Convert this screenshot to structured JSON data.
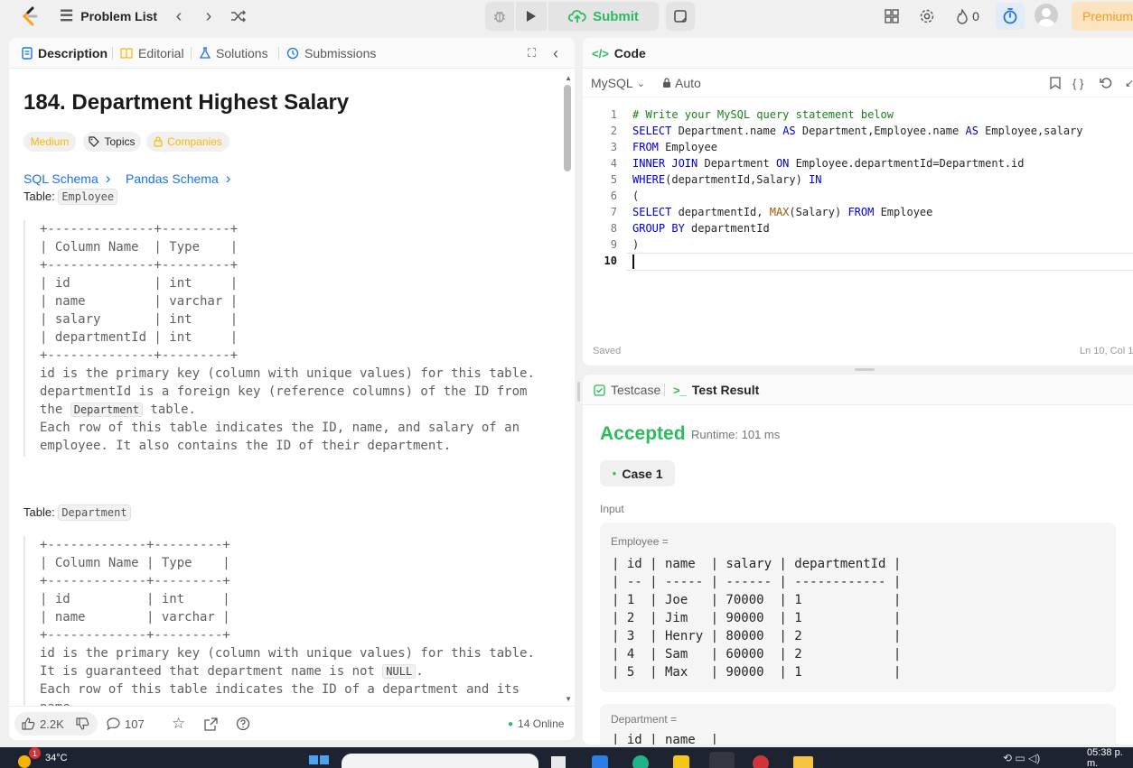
{
  "topbar": {
    "problem_list": "Problem List",
    "submit": "Submit",
    "streak_count": "0",
    "premium": "Premium"
  },
  "colors": {
    "accent_green": "#2cbb5d",
    "link_blue": "#1a73e8",
    "medium_orange": "#ffb800",
    "premium_orange": "#f0a020"
  },
  "left_tabs": [
    "Description",
    "Editorial",
    "Solutions",
    "Submissions"
  ],
  "problem": {
    "title": "184. Department Highest Salary",
    "difficulty": "Medium",
    "topics": "Topics",
    "companies": "Companies",
    "links": [
      "SQL Schema",
      "Pandas Schema"
    ],
    "table_word": "Table:",
    "table1_name": "Employee",
    "table2_name": "Department",
    "employee_schema": [
      "+--------------+---------+",
      "| Column Name  | Type    |",
      "+--------------+---------+",
      "| id           | int     |",
      "| name         | varchar |",
      "| salary       | int     |",
      "| departmentId | int     |",
      "+--------------+---------+",
      "id is the primary key (column with unique values) for this table.",
      "departmentId is a foreign key (reference columns) of the ID from"
    ],
    "employee_note_line11_pre": "the ",
    "employee_note_chip": "Department",
    "employee_note_line11_post": " table.",
    "employee_notes_tail": [
      "Each row of this table indicates the ID, name, and salary of an",
      "employee. It also contains the ID of their department."
    ],
    "department_schema": [
      "+-------------+---------+",
      "| Column Name | Type    |",
      "+-------------+---------+",
      "| id          | int     |",
      "| name        | varchar |",
      "+-------------+---------+",
      "id is the primary key (column with unique values) for this table."
    ],
    "dept_note_pre": "It is guaranteed that department name is not ",
    "dept_note_chip": "NULL",
    "dept_note_post": ".",
    "dept_notes_tail": [
      "Each row of this table indicates the ID of a department and its",
      "name."
    ]
  },
  "left_footer": {
    "likes": "2.2K",
    "comments": "107",
    "online": "14 Online"
  },
  "code_panel": {
    "title": "Code",
    "language": "MySQL",
    "mode": "Auto",
    "saved": "Saved",
    "cursor_pos": "Ln 10, Col 1",
    "line_numbers": [
      "1",
      "2",
      "3",
      "4",
      "5",
      "6",
      "7",
      "8",
      "9",
      "10"
    ]
  },
  "result_panel": {
    "tab_testcase": "Testcase",
    "tab_result": "Test Result",
    "status": "Accepted",
    "runtime": "Runtime: 101 ms",
    "case": "Case 1",
    "input_label": "Input",
    "employee_label": "Employee =",
    "employee_lines": [
      "| id | name  | salary | departmentId |",
      "| -- | ----- | ------ | ------------ |",
      "| 1  | Joe   | 70000  | 1            |",
      "| 2  | Jim   | 90000  | 1            |",
      "| 3  | Henry | 80000  | 2            |",
      "| 4  | Sam   | 60000  | 2            |",
      "| 5  | Max   | 90000  | 1            |"
    ],
    "department_label": "Department =",
    "department_first_line": "| id | name  |"
  },
  "taskbar": {
    "weather": "34°C",
    "badge": "1",
    "time": "05:38 p. m."
  }
}
